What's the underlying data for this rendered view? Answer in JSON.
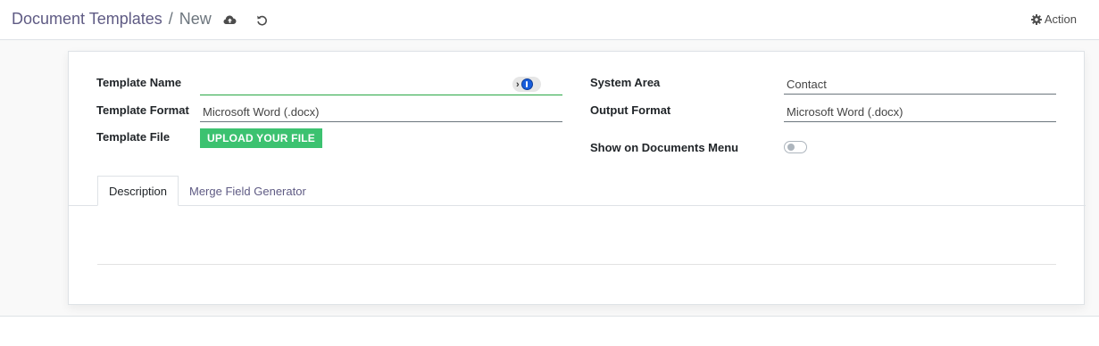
{
  "header": {
    "breadcrumb_parent": "Document Templates",
    "breadcrumb_separator": "/",
    "breadcrumb_current": "New",
    "save_icon": "cloud-upload-icon",
    "discard_icon": "undo-icon",
    "action_label": "Action",
    "action_icon": "gear-icon"
  },
  "form": {
    "template_name": {
      "label": "Template Name",
      "value": ""
    },
    "template_format": {
      "label": "Template Format",
      "value": "Microsoft Word (.docx)"
    },
    "template_file": {
      "label": "Template File",
      "button": "UPLOAD YOUR FILE"
    },
    "system_area": {
      "label": "System Area",
      "value": "Contact"
    },
    "output_format": {
      "label": "Output Format",
      "value": "Microsoft Word (.docx)"
    },
    "show_on_documents_menu": {
      "label": "Show on Documents Menu",
      "checked": false
    }
  },
  "tabs": [
    {
      "label": "Description",
      "active": true
    },
    {
      "label": "Merge Field Generator",
      "active": false
    }
  ],
  "colors": {
    "brand": "#5f5b84",
    "upload_button": "#3cc270",
    "active_field_underline": "#28a745"
  }
}
